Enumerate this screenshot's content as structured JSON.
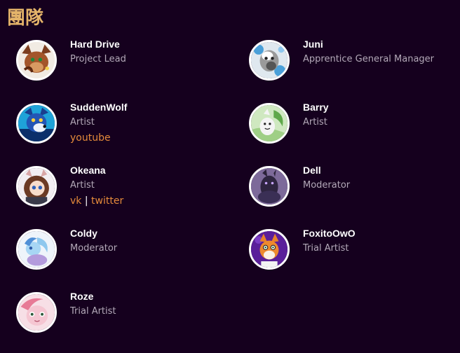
{
  "page": {
    "title": "團隊"
  },
  "colors": {
    "background": "#15001e",
    "title": "#e4b46a",
    "link": "#e58a3b",
    "role": "#b3a9b8"
  },
  "members": [
    {
      "name": "Hard Drive",
      "role": "Project Lead",
      "avatar_icon": "brown-furry-avatar"
    },
    {
      "name": "Juni",
      "role": "Apprentice General Manager",
      "avatar_icon": "grey-blue-avatar"
    },
    {
      "name": "SuddenWolf",
      "role": "Artist",
      "links": [
        "youtube"
      ],
      "avatar_icon": "blue-wolf-avatar"
    },
    {
      "name": "Barry",
      "role": "Artist",
      "avatar_icon": "green-mouse-avatar"
    },
    {
      "name": "Okeana",
      "role": "Artist",
      "links": [
        "vk",
        "twitter"
      ],
      "link_separator": "|",
      "avatar_icon": "brown-hair-girl-avatar"
    },
    {
      "name": "Dell",
      "role": "Moderator",
      "avatar_icon": "purple-dark-avatar"
    },
    {
      "name": "Coldy",
      "role": "Moderator",
      "avatar_icon": "light-blue-pony-avatar"
    },
    {
      "name": "FoxitoOwO",
      "role": "Trial Artist",
      "avatar_icon": "orange-fox-avatar"
    },
    {
      "name": "Roze",
      "role": "Trial Artist",
      "avatar_icon": "pink-pony-avatar"
    }
  ]
}
